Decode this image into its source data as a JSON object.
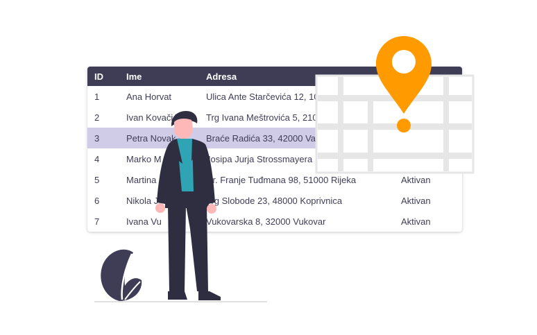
{
  "table": {
    "columns": [
      "ID",
      "Ime",
      "Adresa"
    ],
    "selected_row": 3,
    "rows": [
      {
        "id": "1",
        "ime": "Ana Horvat",
        "adresa": "Ulica Ante Starčevića 12, 10",
        "status": ""
      },
      {
        "id": "2",
        "ime": "Ivan Kovačić",
        "adresa": "Trg Ivana Meštrovića 5, 210",
        "status": ""
      },
      {
        "id": "3",
        "ime": "Petra Novak",
        "adresa": "Braće Radića 33, 42000 Va",
        "status": ""
      },
      {
        "id": "4",
        "ime": "Marko M",
        "adresa": "Josipa Jurja Strossmayera",
        "status": ""
      },
      {
        "id": "5",
        "ime": "Martina",
        "adresa": "Dr. Franje Tuđmana 98, 51000 Rijeka",
        "status": "Aktivan"
      },
      {
        "id": "6",
        "ime": "Nikola J",
        "adresa": "Trg Slobode 23, 48000 Koprivnica",
        "status": "Aktivan"
      },
      {
        "id": "7",
        "ime": "Ivana Vu",
        "adresa": "Vukovarska 8, 32000 Vukovar",
        "status": "Aktivan"
      }
    ]
  },
  "illustration": {
    "person": "person-standing-icon",
    "map": "map-grid-icon",
    "pin": "location-pin-icon",
    "plant": "plant-leaf-icon"
  },
  "colors": {
    "header_bg": "#3f3d56",
    "selected_row": "#d0cce8",
    "pin": "#ff9b00",
    "accent": "#2fa4b5",
    "map_lines": "#e6e6e6"
  }
}
